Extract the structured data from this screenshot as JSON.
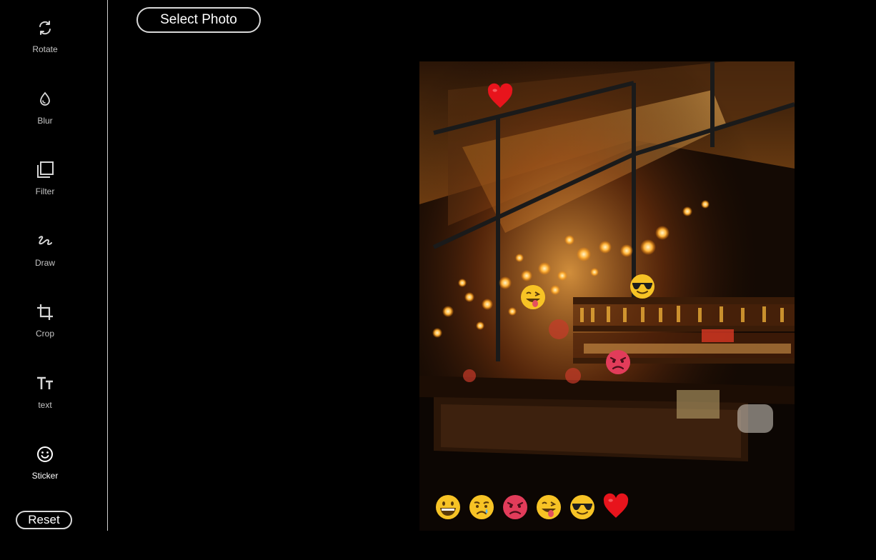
{
  "sidebar": {
    "tools": [
      {
        "label": "Rotate",
        "icon": "rotate-icon"
      },
      {
        "label": "Blur",
        "icon": "blur-drop-icon"
      },
      {
        "label": "Filter",
        "icon": "filter-layers-icon"
      },
      {
        "label": "Draw",
        "icon": "draw-squiggle-icon"
      },
      {
        "label": "Crop",
        "icon": "crop-icon"
      },
      {
        "label": "text",
        "icon": "text-size-icon"
      },
      {
        "label": "Sticker",
        "icon": "smiley-icon",
        "active": true
      }
    ],
    "reset_label": "Reset"
  },
  "toolbar": {
    "select_photo_label": "Select Photo"
  },
  "canvas": {
    "placed_stickers": [
      "heart",
      "tongue-out",
      "sunglasses",
      "angry"
    ]
  },
  "sticker_tray": [
    "grin",
    "crying",
    "angry",
    "tongue-out",
    "sunglasses",
    "heart"
  ],
  "colors": {
    "background": "#000000",
    "divider": "#cfcfcf",
    "heart": "#e8141c",
    "emoji_yellow": "#f7c325",
    "angry_red": "#e23c5a"
  }
}
